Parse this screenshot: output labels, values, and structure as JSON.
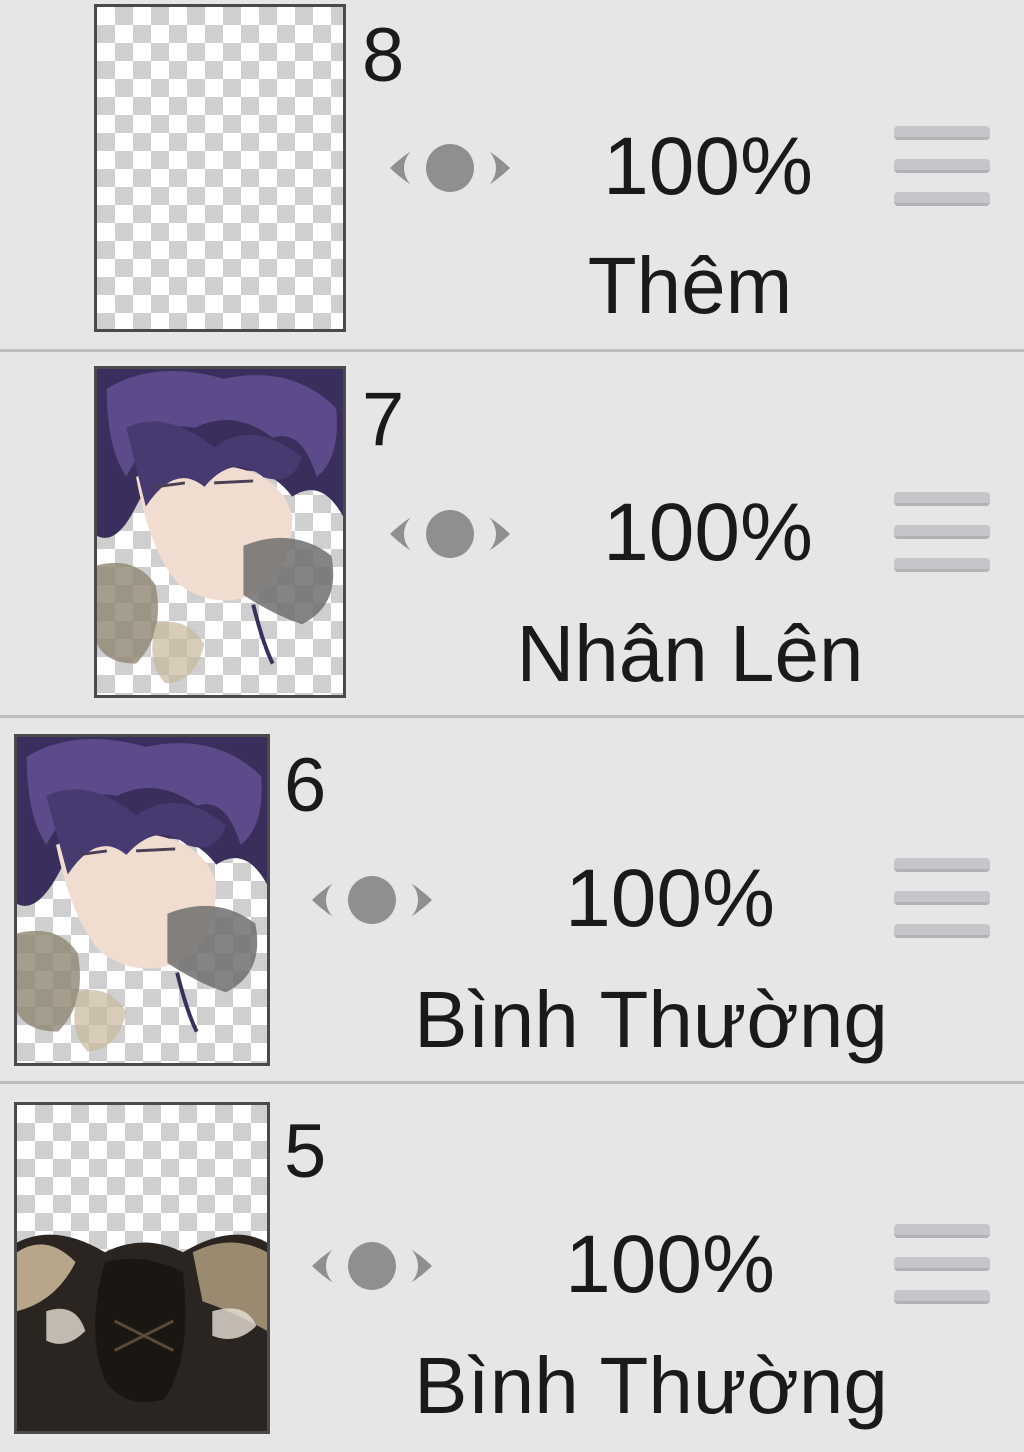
{
  "layers": [
    {
      "number": "8",
      "opacity": "100%",
      "blend_mode": "Thêm",
      "clipped": true,
      "thumbnail": "transparent"
    },
    {
      "number": "7",
      "opacity": "100%",
      "blend_mode": "Nhân Lên",
      "clipped": true,
      "thumbnail": "portrait"
    },
    {
      "number": "6",
      "opacity": "100%",
      "blend_mode": "Bình Thường",
      "clipped": false,
      "thumbnail": "portrait"
    },
    {
      "number": "5",
      "opacity": "100%",
      "blend_mode": "Bình Thường",
      "clipped": false,
      "thumbnail": "dark-clothing"
    }
  ],
  "icons": {
    "visibility": "eye-icon",
    "reorder": "drag-handle-icon",
    "clip": "clipping-arrow-icon"
  },
  "colors": {
    "panel_bg": "#e6e6e6",
    "divider": "#bdbdbd",
    "eye": "#8f8f8f",
    "handle": "#c6c6ca",
    "text": "#1a1a1a"
  }
}
